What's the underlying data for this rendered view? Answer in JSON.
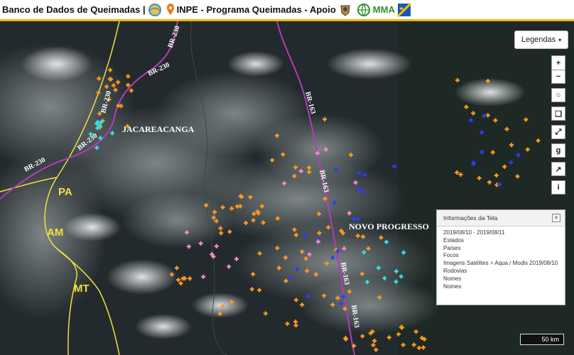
{
  "header": {
    "title_left": "Banco de Dados de Queimadas |",
    "title_mid": "INPE - Programa Queimadas - Apoio",
    "title_right": "MMA",
    "icons": [
      "globe-icon",
      "location-pin-icon",
      "coat-of-arms-icon",
      "globe-ministry-icon",
      "star-flag-icon"
    ]
  },
  "map": {
    "place_labels": {
      "jacareacanga": "JACAREACANGA",
      "novo_progresso": "NOVO PROGRESSO"
    },
    "state_labels": {
      "pa": "PA",
      "am": "AM",
      "mt": "MT"
    },
    "road_labels": [
      "BR-230",
      "BR-230",
      "BR-230",
      "BR-230",
      "BR-230",
      "BR-163",
      "BR-163",
      "BR-163",
      "BR-163"
    ],
    "colors": {
      "fire_orange": "#ff9a1f",
      "fire_blue": "#2a3cff",
      "fire_pink": "#ff88c8",
      "fire_cyan": "#35e0e8",
      "road": "#b43cb4",
      "border": "#f0e040"
    }
  },
  "legend_button": {
    "label": "Legendas"
  },
  "tools": {
    "zoom_in": "+",
    "zoom_out": "−",
    "info": "i",
    "icons": [
      "zoom-in-icon",
      "zoom-out-icon",
      "circle-select-icon",
      "crop-icon",
      "fullscreen-icon",
      "google-icon",
      "chart-icon",
      "info-icon"
    ]
  },
  "info_panel": {
    "title": "Informações da Tela",
    "close": "×",
    "lines": [
      "2019/08/10 - 2019/08/11",
      "Estados",
      "Países",
      "Focos",
      "Imagens Satélites > Aqua / Modis 2019/08/10",
      "Rodovias",
      "Nomes",
      "Nomes"
    ]
  },
  "scale_bar": {
    "label": "50 km"
  }
}
